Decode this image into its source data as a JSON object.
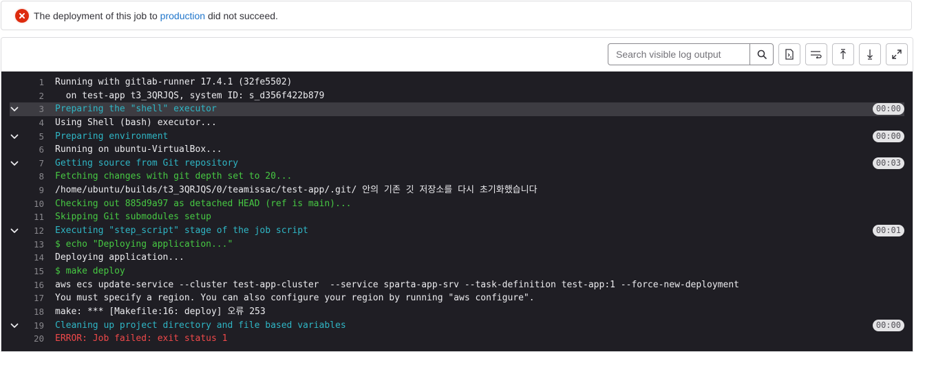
{
  "alert": {
    "prefix": "The deployment of this job to ",
    "link": "production",
    "suffix": " did not succeed."
  },
  "toolbar": {
    "search_placeholder": "Search visible log output",
    "buttons": [
      "search-icon",
      "raw-log-icon",
      "scroll-to-top-icon",
      "scroll-to-bottom-icon",
      "fullscreen-icon"
    ]
  },
  "log": {
    "lines": [
      {
        "n": "1",
        "text": "Running with gitlab-runner 17.4.1 (32fe5502)",
        "color": "default"
      },
      {
        "n": "2",
        "text": "  on test-app t3_3QRJQS, system ID: s_d356f422b879",
        "color": "default"
      },
      {
        "n": "3",
        "text": "Preparing the \"shell\" executor",
        "color": "cyan",
        "section": true,
        "duration": "00:00",
        "highlight": true
      },
      {
        "n": "4",
        "text": "Using Shell (bash) executor...",
        "color": "default"
      },
      {
        "n": "5",
        "text": "Preparing environment",
        "color": "cyan",
        "section": true,
        "duration": "00:00"
      },
      {
        "n": "6",
        "text": "Running on ubuntu-VirtualBox...",
        "color": "default"
      },
      {
        "n": "7",
        "text": "Getting source from Git repository",
        "color": "cyan",
        "section": true,
        "duration": "00:03"
      },
      {
        "n": "8",
        "text": "Fetching changes with git depth set to 20...",
        "color": "green"
      },
      {
        "n": "9",
        "text": "/home/ubuntu/builds/t3_3QRJQS/0/teamissac/test-app/.git/ 안의 기존 깃 저장소를 다시 초기화했습니다",
        "color": "default"
      },
      {
        "n": "10",
        "text": "Checking out 885d9a97 as detached HEAD (ref is main)...",
        "color": "green"
      },
      {
        "n": "11",
        "text": "Skipping Git submodules setup",
        "color": "green"
      },
      {
        "n": "12",
        "text": "Executing \"step_script\" stage of the job script",
        "color": "cyan",
        "section": true,
        "duration": "00:01"
      },
      {
        "n": "13",
        "text": "$ echo \"Deploying application...\"",
        "color": "green"
      },
      {
        "n": "14",
        "text": "Deploying application...",
        "color": "default"
      },
      {
        "n": "15",
        "text": "$ make deploy",
        "color": "green"
      },
      {
        "n": "16",
        "text": "aws ecs update-service --cluster test-app-cluster  --service sparta-app-srv --task-definition test-app:1 --force-new-deployment",
        "color": "default"
      },
      {
        "n": "17",
        "text": "You must specify a region. You can also configure your region by running \"aws configure\".",
        "color": "default"
      },
      {
        "n": "18",
        "text": "make: *** [Makefile:16: deploy] 오류 253",
        "color": "default"
      },
      {
        "n": "19",
        "text": "Cleaning up project directory and file based variables",
        "color": "cyan",
        "section": true,
        "duration": "00:00"
      },
      {
        "n": "20",
        "text": "ERROR: Job failed: exit status 1",
        "color": "red"
      }
    ]
  },
  "colors": {
    "log_bg": "#1f1e24",
    "cyan": "#2fb6c5",
    "green": "#47c943",
    "red": "#f0494a",
    "error_icon": "#dd2b0e",
    "link": "#1f75cb"
  }
}
